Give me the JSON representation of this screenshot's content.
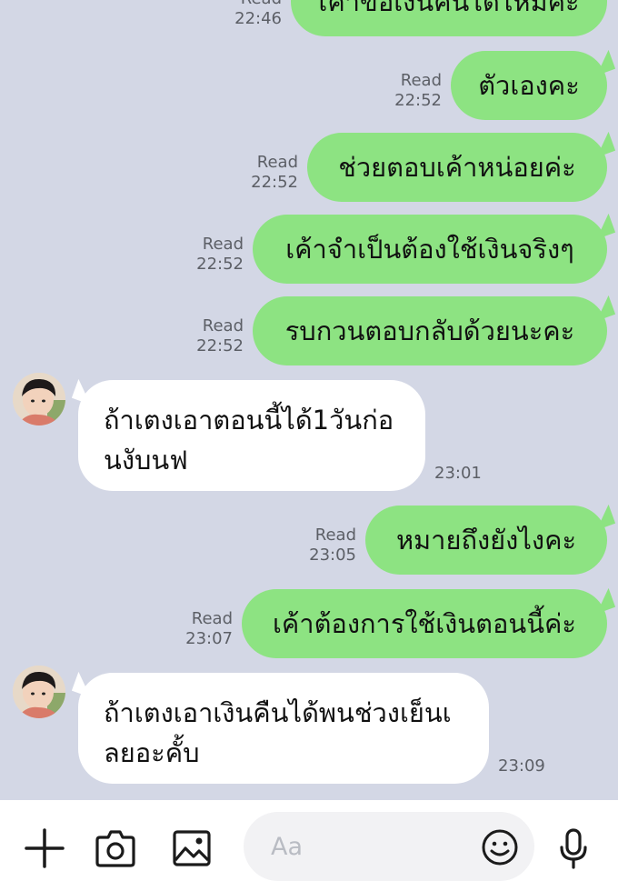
{
  "messages": [
    {
      "dir": "out",
      "text": "เค้าขอเงินคืนได้ไหมคะ",
      "read": "Read",
      "time": "22:46"
    },
    {
      "dir": "out",
      "text": "ตัวเองคะ",
      "read": "Read",
      "time": "22:52"
    },
    {
      "dir": "out",
      "text": "ช่วยตอบเค้าหน่อยค่ะ",
      "read": "Read",
      "time": "22:52"
    },
    {
      "dir": "out",
      "text": "เค้าจำเป็นต้องใช้เงินจริงๆ",
      "read": "Read",
      "time": "22:52"
    },
    {
      "dir": "out",
      "text": "รบกวนตอบกลับด้วยนะคะ",
      "read": "Read",
      "time": "22:52"
    },
    {
      "dir": "in",
      "text": "ถ้าเตงเอาตอนนี้ได้1วันก่อนงับนฟ",
      "time": "23:01"
    },
    {
      "dir": "out",
      "text": "หมายถึงยังไงคะ",
      "read": "Read",
      "time": "23:05"
    },
    {
      "dir": "out",
      "text": "เค้าต้องการใช้เงินตอนนี้ค่ะ",
      "read": "Read",
      "time": "23:07"
    },
    {
      "dir": "in",
      "text": " ถ้าเตงเอาเงินคืนได้พนช่วงเย็นเลยอะคั้บ",
      "time": "23:09"
    }
  ],
  "composer": {
    "placeholder": "Aa",
    "icons": [
      "plus-icon",
      "camera-icon",
      "image-icon",
      "emoji-icon",
      "microphone-icon"
    ]
  },
  "colors": {
    "background": "#d3d7e5",
    "outgoing_bubble": "#8de382",
    "incoming_bubble": "#ffffff",
    "meta_text": "#5c5f66"
  }
}
